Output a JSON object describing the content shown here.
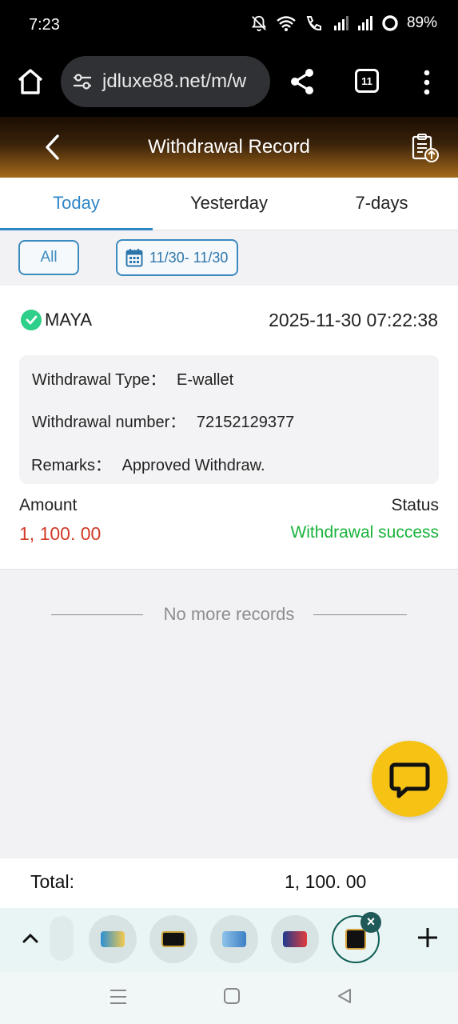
{
  "status_bar": {
    "time": "7:23",
    "battery": "89%",
    "icons": [
      "mute-icon",
      "wifi-icon",
      "wifi-call-icon",
      "signal-icon",
      "signal-icon",
      "battery-ring-icon"
    ]
  },
  "browser": {
    "url": "jdluxe88.net/m/w",
    "tab_count": "11",
    "icons": [
      "home-icon",
      "site-settings-icon",
      "share-icon",
      "tab-switcher-icon",
      "more-menu-icon"
    ]
  },
  "header": {
    "title": "Withdrawal Record",
    "icons": [
      "back-icon",
      "clipboard-upload-icon"
    ]
  },
  "tabs": [
    {
      "label": "Today",
      "active": true
    },
    {
      "label": "Yesterday",
      "active": false
    },
    {
      "label": "7-days",
      "active": false
    }
  ],
  "filters": {
    "all_label": "All",
    "date_range": "11/30- 11/30",
    "icon": "calendar-icon"
  },
  "record": {
    "provider": "MAYA",
    "datetime": "2025-11-30 07:22:38",
    "details": [
      {
        "label": "Withdrawal Type：",
        "value": "E-wallet"
      },
      {
        "label": "Withdrawal number：",
        "value": "72152129377"
      },
      {
        "label": "Remarks：",
        "value": "Approved Withdraw."
      }
    ],
    "amount_label": "Amount",
    "status_label": "Status",
    "amount": "1, 100. 00",
    "status": "Withdrawal success",
    "colors": {
      "amount": "#d23b28",
      "status": "#19b33c"
    }
  },
  "list_end_text": "No more records",
  "total": {
    "label": "Total:",
    "value": "1, 100. 00"
  },
  "accent_color": "#2f86c7"
}
